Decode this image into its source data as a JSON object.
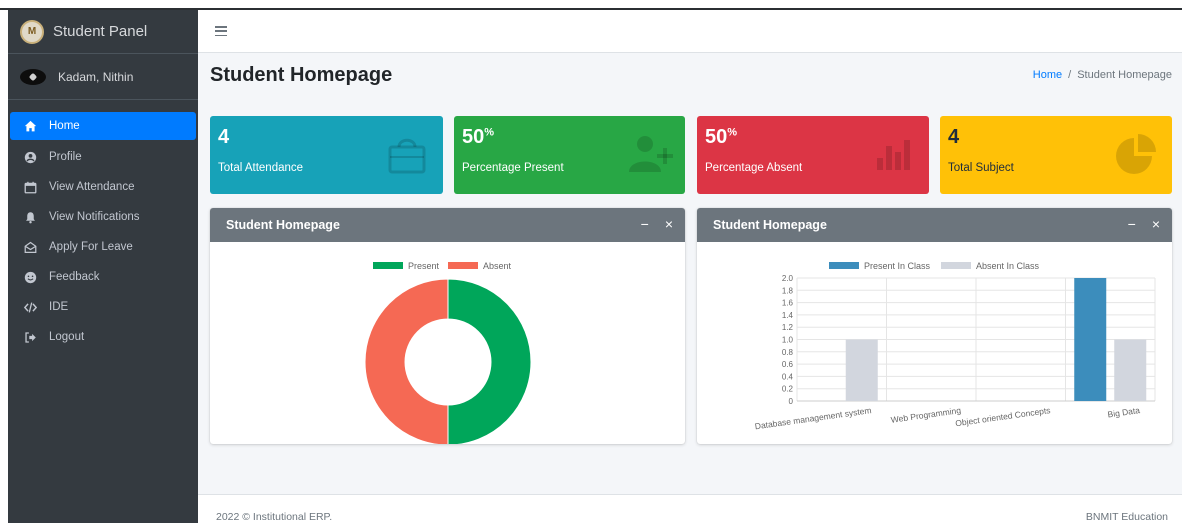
{
  "sidebar": {
    "brand": "Student Panel",
    "logo_text": "M",
    "user_name": "Kadam, Nithin",
    "items": [
      {
        "label": "Home",
        "icon": "home-icon"
      },
      {
        "label": "Profile",
        "icon": "profile-icon"
      },
      {
        "label": "View Attendance",
        "icon": "calendar-icon"
      },
      {
        "label": "View Notifications",
        "icon": "bell-icon"
      },
      {
        "label": "Apply For Leave",
        "icon": "envelope-icon"
      },
      {
        "label": "Feedback",
        "icon": "feedback-icon"
      },
      {
        "label": "IDE",
        "icon": "code-icon"
      },
      {
        "label": "Logout",
        "icon": "logout-icon"
      }
    ]
  },
  "header": {
    "title": "Student Homepage",
    "breadcrumb_home": "Home",
    "breadcrumb_sep": "/",
    "breadcrumb_current": "Student Homepage"
  },
  "stats": [
    {
      "value": "4",
      "sup": "",
      "label": "Total Attendance",
      "color": "#17a2b8",
      "icon": "shopping-bag-icon"
    },
    {
      "value": "50",
      "sup": "%",
      "label": "Percentage Present",
      "color": "#28a745",
      "icon": "user-plus-icon"
    },
    {
      "value": "50",
      "sup": "%",
      "label": "Percentage Absent",
      "color": "#dc3545",
      "icon": "bar-chart-icon"
    },
    {
      "value": "4",
      "sup": "",
      "label": "Total Subject",
      "color": "#ffc107",
      "icon": "pie-chart-icon"
    }
  ],
  "cards": {
    "left_title": "Student Homepage",
    "right_title": "Student Homepage",
    "minimize": "−",
    "close": "×"
  },
  "chart_data": [
    {
      "type": "pie",
      "donut": true,
      "labels": [
        "Present",
        "Absent"
      ],
      "values": [
        50,
        50
      ],
      "colors": [
        "#00a65a",
        "#f56954"
      ],
      "legend": "top"
    },
    {
      "type": "bar",
      "categories": [
        "Database management system",
        "Web Programming",
        "Object oriented Concepts",
        "Big Data"
      ],
      "series": [
        {
          "name": "Present In Class",
          "values": [
            0,
            0,
            0,
            2
          ],
          "color": "#3c8dbc"
        },
        {
          "name": "Absent In Class",
          "values": [
            1,
            0,
            0,
            1
          ],
          "color": "#d2d6de"
        }
      ],
      "ylim": [
        0,
        2
      ],
      "yticks": [
        "0",
        "0.2",
        "0.4",
        "0.6",
        "0.8",
        "1.0",
        "1.2",
        "1.4",
        "1.6",
        "1.8",
        "2.0"
      ],
      "legend": "top",
      "grid": true
    }
  ],
  "footer": {
    "left": "2022 © Institutional ERP.",
    "right": "BNMIT Education"
  }
}
